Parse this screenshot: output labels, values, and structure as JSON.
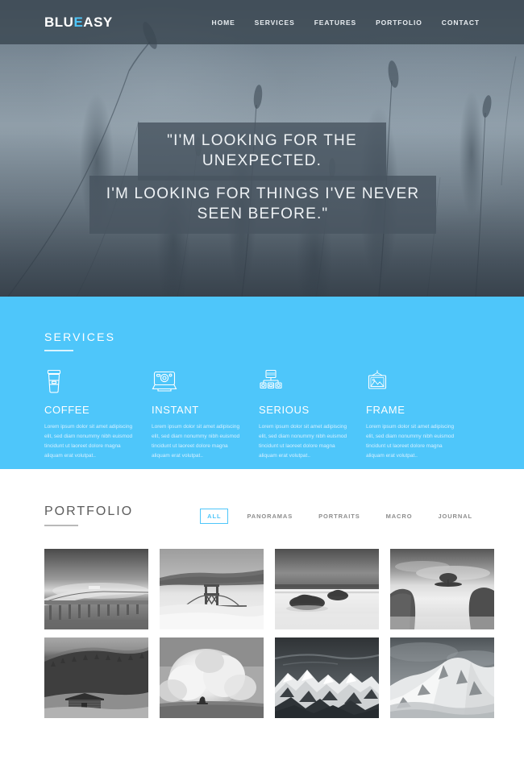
{
  "header": {
    "logo_text": "BLUEASY",
    "logo_prefix": "BLU",
    "logo_accent": "E",
    "logo_suffix": "ASY",
    "accent_color": "#4ec6fa",
    "nav": [
      {
        "label": "HOME",
        "name": "nav-home"
      },
      {
        "label": "SERVICES",
        "name": "nav-services"
      },
      {
        "label": "FEATURES",
        "name": "nav-features"
      },
      {
        "label": "PORTFOLIO",
        "name": "nav-portfolio"
      },
      {
        "label": "CONTACT",
        "name": "nav-contact"
      }
    ]
  },
  "hero": {
    "quote_line_1": "\"I'M LOOKING FOR THE UNEXPECTED.",
    "quote_line_2": "I'M LOOKING FOR THINGS I'VE NEVER SEEN BEFORE.\"",
    "background_image": "grass-field-photo"
  },
  "services": {
    "title": "SERVICES",
    "background_color": "#4ec6fa",
    "items": [
      {
        "title": "COFFEE",
        "icon": "coffee-cup-icon",
        "text": "Lorem ipsum dolor sit amet adipiscing elit, sed diam nonummy nibh euismod tincidunt ut laoreet dolore magna aliquam erat volutpat.."
      },
      {
        "title": "INSTANT",
        "icon": "instant-camera-icon",
        "text": "Lorem ipsum dolor sit amet adipiscing elit, sed diam nonummy nibh euismod tincidunt ut laoreet dolore magna aliquam erat volutpat.."
      },
      {
        "title": "SERIOUS",
        "icon": "desktop-computer-icon",
        "text": "Lorem ipsum dolor sit amet adipiscing elit, sed diam nonummy nibh euismod tincidunt ut laoreet dolore magna aliquam erat volutpat.."
      },
      {
        "title": "FRAME",
        "icon": "picture-frame-icon",
        "text": "Lorem ipsum dolor sit amet adipiscing elit, sed diam nonummy nibh euismod tincidunt ut laoreet dolore magna aliquam erat volutpat.."
      }
    ]
  },
  "portfolio": {
    "title": "PORTFOLIO",
    "filters": [
      {
        "label": "ALL",
        "active": true
      },
      {
        "label": "PANORAMAS",
        "active": false
      },
      {
        "label": "PORTRAITS",
        "active": false
      },
      {
        "label": "MACRO",
        "active": false
      },
      {
        "label": "JOURNAL",
        "active": false
      }
    ],
    "items": [
      {
        "caption": "curved-pier-over-water",
        "style": "pier"
      },
      {
        "caption": "bridge-in-fog",
        "style": "bridge"
      },
      {
        "caption": "sea-rocks-long-exposure",
        "style": "rocks"
      },
      {
        "caption": "lone-tree-on-island",
        "style": "tree"
      },
      {
        "caption": "cabin-below-forest-hill",
        "style": "cabin"
      },
      {
        "caption": "surfer-under-big-wave",
        "style": "wave"
      },
      {
        "caption": "snow-covered-mountain-range",
        "style": "range"
      },
      {
        "caption": "snowy-mountain-peak",
        "style": "peak"
      }
    ]
  }
}
